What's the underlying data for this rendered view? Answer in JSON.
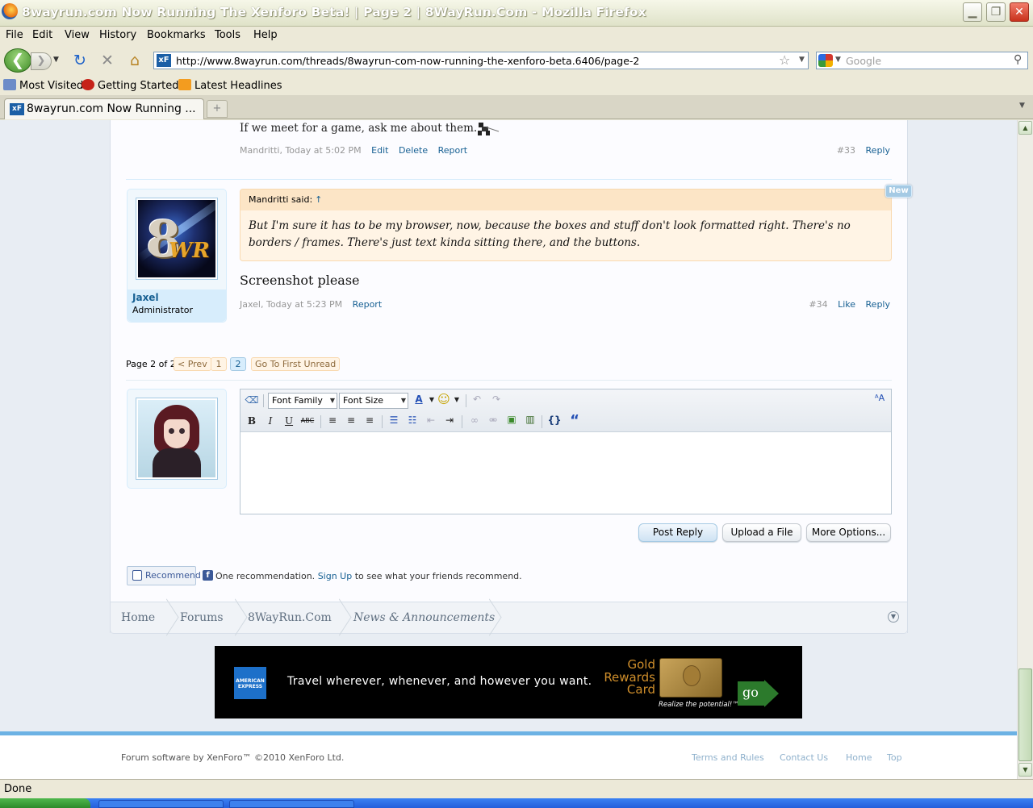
{
  "window": {
    "title": "8wayrun.com Now Running The Xenforo Beta! | Page 2 | 8WayRun.Com - Mozilla Firefox",
    "min_glyph": "▁",
    "max_glyph": "❐",
    "close_glyph": "✕"
  },
  "menu": [
    "File",
    "Edit",
    "View",
    "History",
    "Bookmarks",
    "Tools",
    "Help"
  ],
  "nav": {
    "url": "http://www.8wayrun.com/threads/8wayrun-com-now-running-the-xenforo-beta.6406/page-2",
    "site_icon_text": "xF",
    "search_placeholder": "Google",
    "back_glyph": "❮",
    "forward_glyph": "❯",
    "reload_glyph": "↻",
    "stop_glyph": "✕",
    "home_glyph": "⌂",
    "star_glyph": "☆",
    "search_glyph": "⚲"
  },
  "bookmarks": [
    "Most Visited",
    "Getting Started",
    "Latest Headlines"
  ],
  "tab": {
    "icon_text": "xF",
    "label": "8wayrun.com Now Running ...",
    "new_tab_glyph": "+"
  },
  "prev_post": {
    "signature": "If we meet for a game, ask me about them.",
    "author": "Mandritti",
    "date": ", Today at 5:02 PM",
    "links": [
      "Edit",
      "Delete",
      "Report"
    ],
    "number": "#33",
    "reply": "Reply"
  },
  "post": {
    "username": "Jaxel",
    "user_title": "Administrator",
    "avatar_text": "8",
    "avatar_text2": "WR",
    "new_badge": "New",
    "quote_author": "Mandritti said:",
    "quote_arrow": "↑",
    "quote_text": "But I'm sure it has to be my browser, now, because the boxes and stuff don't look formatted right. There's no borders / frames. There's just text kinda sitting there, and the buttons.",
    "body": "Screenshot please",
    "author": "Jaxel",
    "date": ", Today at 5:23 PM",
    "report": "Report",
    "number": "#34",
    "like": "Like",
    "reply": "Reply"
  },
  "pagenav": {
    "label": "Page 2 of 2",
    "prev": "< Prev",
    "pages": [
      "1",
      "2"
    ],
    "current": "2",
    "first_unread": "Go To First Unread"
  },
  "editor": {
    "font_family": "Font Family",
    "font_size": "Font Size",
    "bold": "B",
    "italic": "I",
    "underline": "U",
    "strike": "ABC",
    "code": "{}",
    "quote": "“"
  },
  "actions": {
    "post_reply": "Post Reply",
    "upload": "Upload a File",
    "more": "More Options..."
  },
  "facebook": {
    "recommend": "Recommend",
    "text_before": "One recommendation.",
    "signup": "Sign Up",
    "text_after": "to see what your friends recommend."
  },
  "breadcrumb": [
    "Home",
    "Forums",
    "8WayRun.Com",
    "News & Announcements"
  ],
  "ad": {
    "brand": "AMERICAN EXPRESS",
    "slogan": "Travel wherever, whenever, and however you want.",
    "product": "Gold Rewards Card",
    "tagline": "Realize the potential!™",
    "cta": "go"
  },
  "footer": {
    "copyright": "Forum software by XenForo™ ©2010 XenForo Ltd.",
    "links": [
      "Terms and Rules",
      "Contact Us",
      "Home",
      "Top"
    ]
  },
  "status": "Done"
}
